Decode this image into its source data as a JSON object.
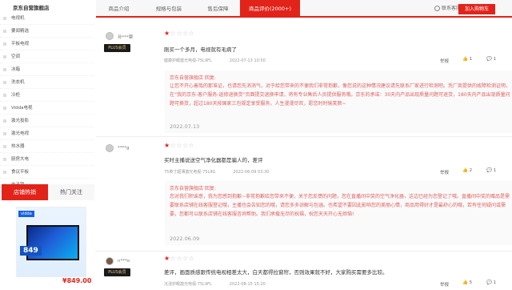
{
  "left": {
    "shop_name": "京东自营旗舰店",
    "categories": [
      "电视机",
      "要闻精选",
      "平板电视",
      "空调",
      "冰箱",
      "洗衣机",
      "冷柜",
      "Vidda电视",
      "激光投影",
      "激光电视",
      "热水器",
      "厨房大电",
      "食议平板",
      "电子锁"
    ],
    "tabs": {
      "hot": "店铺热销",
      "follow": "热门关注"
    },
    "hot_item": {
      "tag": "vidda",
      "number": "849",
      "price": "¥849.00"
    }
  },
  "topbar": {
    "tabs": [
      "商品介绍",
      "规格与包装",
      "售后保障",
      "商品评价(2000+)"
    ],
    "service": "联系客服",
    "cart": "加入购物车"
  },
  "reviews": [
    {
      "user": "孙***票",
      "badge": "PLUS会员",
      "rating": 1,
      "text": "刚买一个多月，电视就有毛病了",
      "product": "健康护眼激光电视-75L9FL",
      "date": "2022-07-13 10:50",
      "report": "举报",
      "likes": "1",
      "comments": "1",
      "reply": {
        "header": "京东自营旗舰店 回复:",
        "body": "让您不开心善哉的那准证，也请您先消消气，对于给您带来的不便我们非常抱歉，像您说的这种情况建议请先联系厂家进行检测吧。凭厂商提供的故障检测证明，在“我的京东-客户服务-返修退换货”页面提交退换申请，将有专业售后人员提供服务哦。京东的承诺：30天内产品出现质量问题可退货，180天内产品出现质量问题可换货，超过180天按国家三包规定享受服务，人生漫漫尽欢，愿您时时愉笑颜~",
        "date": "2022.07.13"
      }
    },
    {
      "user": "****g",
      "badge": "",
      "rating": 1,
      "text": "买时主播说送空气净化器都是骗人的，差评",
      "product": "75英寸超薄激光电视-75L9G",
      "date": "2022-06-09 03:30",
      "report": "举报",
      "likes": "2",
      "comments": "1",
      "reply": {
        "header": "京东自营旗舰店 回复:",
        "body": "您对我们积诶意，我为您感到抱歉~非常抱歉给您带来不便，关于您反馈的问题，您在直播间中奖的空气净化器，这边已经为您登记了哦。直播间中奖的赠品是需要联系店铺在线客服登记哦，主播也会告知您的哦，请您多多谅解与包涵。也希望不要因此影响您的美丽心情，商品用得好才是最舒心的哦，若有任何疑问或需要，您都可以联系店铺在线客服咨询帮助。我们承载无尽的祝福，祝您天天开心无烦恼!",
        "date": "2022.06.09"
      }
    },
    {
      "user": "n***o",
      "badge": "PLUS会员",
      "rating": 1,
      "text": "差评，画面质感跟传统电视相差太大，白天都得拉窗帘，否则效果就不好，大家购买需要多比较。",
      "product": "沉浸护眼激光电视-75L9FL",
      "date": "2022-08-15 15:20",
      "report": "举报",
      "likes": "5",
      "comments": "1"
    }
  ],
  "colors": {
    "accent": "#e2231a",
    "reply": "#e06060",
    "plus_bg": "#1b1b1b",
    "plus_fg": "#e8c98b"
  }
}
